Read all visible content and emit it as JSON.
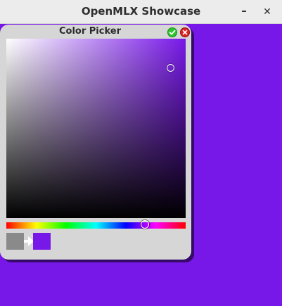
{
  "window": {
    "title": "OpenMLX Showcase",
    "minimize_glyph": "–",
    "close_glyph": "✕"
  },
  "dialog": {
    "title": "Color Picker",
    "ok_icon": "check-icon",
    "cancel_icon": "close-icon"
  },
  "picker": {
    "current_color": "#7818e8",
    "previous_color": "#8a8a8a",
    "hue_fraction": 0.76,
    "saturation_fraction": 0.92,
    "value_fraction": 0.91
  }
}
